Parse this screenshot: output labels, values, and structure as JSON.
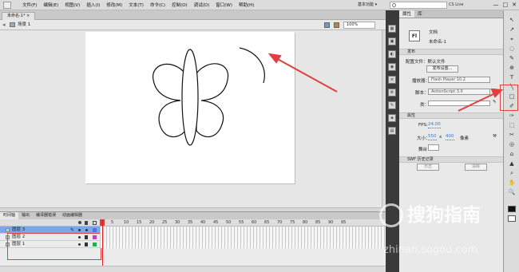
{
  "menubar": {
    "items": [
      "文件(F)",
      "编辑(E)",
      "视图(V)",
      "插入(I)",
      "修改(M)",
      "文本(T)",
      "命令(C)",
      "控制(O)",
      "调试(D)",
      "窗口(W)",
      "帮助(H)"
    ],
    "workspace": "基本功能 ▾",
    "search_value": "",
    "cs_live": "CS Live",
    "window_buttons": [
      "—",
      "□",
      "✕"
    ]
  },
  "document": {
    "tab_label": "未命名-1* ×",
    "scene_label": "场景 1",
    "zoom": "100%"
  },
  "timeline": {
    "tabs": [
      "时间轴",
      "输出",
      "编译器错误",
      "动画编辑器"
    ],
    "frame_numbers": [
      "5",
      "10",
      "15",
      "20",
      "25",
      "30",
      "35",
      "40",
      "45",
      "50",
      "55",
      "60",
      "65",
      "70",
      "75",
      "80",
      "85",
      "90",
      "95"
    ],
    "layers": [
      {
        "name": "图层 3",
        "selected": true,
        "color": "#4a7be0"
      },
      {
        "name": "图层 2",
        "selected": false,
        "color": "#c040c0"
      },
      {
        "name": "图层 1",
        "selected": false,
        "color": "#20b050"
      }
    ]
  },
  "properties": {
    "tabs": [
      "属性",
      "库"
    ],
    "doc_icon": "Fl",
    "doc_type": "文档",
    "doc_name": "未命名-1",
    "section_publish": "发布",
    "profile_label": "配置文件：默认文件",
    "publish_settings_button": "发布设置...",
    "player_label": "播放器：",
    "player_value": "Flash Player 10.2",
    "script_label": "脚本：",
    "script_value": "ActionScript 3.0",
    "class_label": "类：",
    "class_value": "",
    "section_props": "属性",
    "fps_label": "FPS:",
    "fps_value": "24.00",
    "size_label": "大小：",
    "width_value": "550",
    "x_sep": "x",
    "height_value": "400",
    "unit": "像素",
    "edit_button": "编辑...",
    "stage_label": "舞台：",
    "section_swf": "SWF 历史记录",
    "log_button": "日志",
    "clear_button": "清除"
  },
  "dock_icons": [
    "▦",
    "▣",
    "◐",
    "◉",
    "≡",
    "⚙",
    "✎",
    "◈",
    "▤"
  ],
  "tools": [
    "↖",
    "↗",
    "⌖",
    "◌",
    "✎",
    "⊕",
    "T",
    "╲",
    "□",
    "✐",
    "✑",
    "⬚",
    "✂",
    "◎",
    "⌂",
    "▲",
    "⌕",
    "✋",
    "🔍"
  ],
  "colors": {
    "annotation": "#e04040"
  },
  "watermark": {
    "text": "搜狗指南",
    "url": "zhinan.sogou.com"
  }
}
